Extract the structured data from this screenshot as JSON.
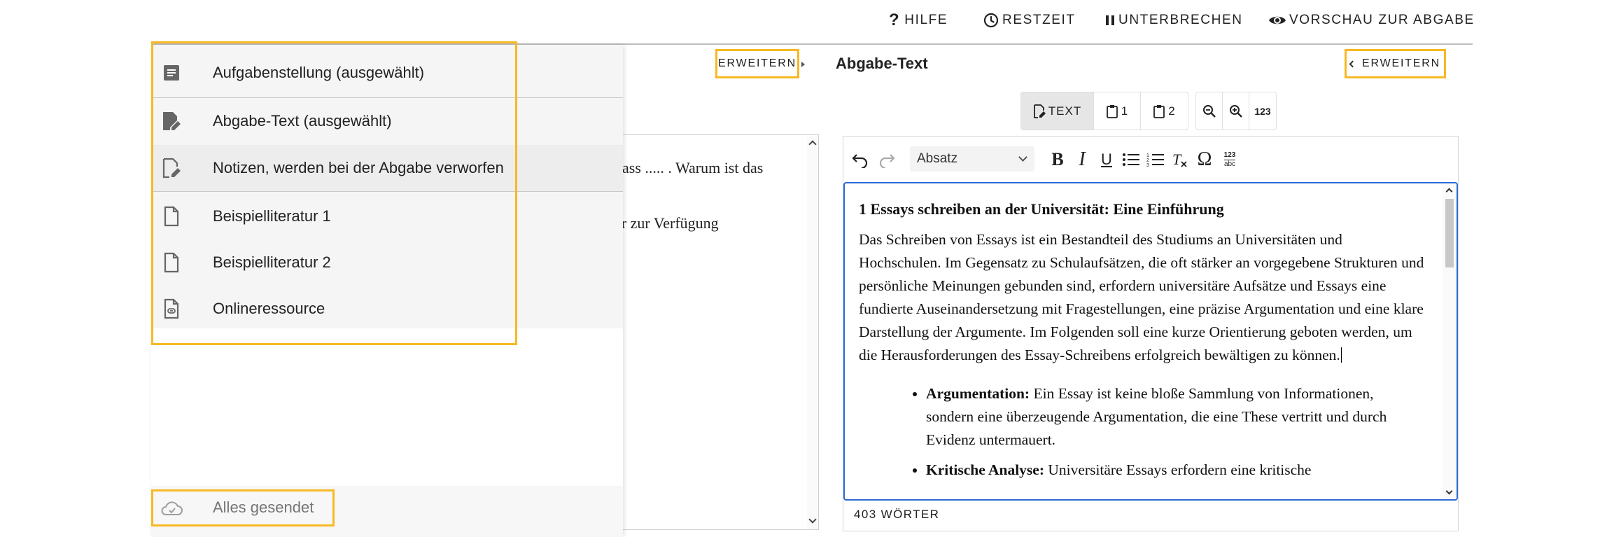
{
  "topbar": {
    "help_label": "HILFE",
    "remaining_label": "RESTZEIT",
    "pause_label": "UNTERBRECHEN",
    "preview_label": "VORSCHAU ZUR ABGABE"
  },
  "left_pane": {
    "expand_label": "ERWEITERN",
    "text_line_1": "dass ..... . Warum ist das",
    "text_line_2": "er zur Verfügung"
  },
  "drawer": {
    "items": [
      {
        "icon": "description-icon",
        "label": "Aufgabenstellung (ausgewählt)"
      },
      {
        "icon": "edit-document-icon",
        "label": "Abgabe-Text (ausgewählt)"
      },
      {
        "icon": "edit-note-icon",
        "label": "Notizen, werden bei der Abgabe verworfen"
      },
      {
        "icon": "file-icon",
        "label": "Beispielliteratur 1"
      },
      {
        "icon": "file-icon",
        "label": "Beispielliteratur 2"
      },
      {
        "icon": "link-file-icon",
        "label": "Onlineressource"
      }
    ],
    "status_label": "Alles gesendet",
    "status_icon": "cloud-done-icon"
  },
  "right_pane": {
    "title": "Abgabe-Text",
    "expand_label": "ERWEITERN",
    "view_toggle": {
      "text_label": "TEXT",
      "page1_label": "1",
      "page2_label": "2"
    },
    "zoom": {
      "counter_label": "123"
    },
    "toolbar": {
      "paragraph_select": "Absatz",
      "spellcheck_top": "123",
      "spellcheck_bottom": "abc"
    },
    "editor": {
      "heading": "1 Essays schreiben an der Universität: Eine Einführung",
      "paragraph": "Das Schreiben von Essays ist ein Bestandteil des Studiums an Universitäten und Hochschulen. Im Gegensatz zu Schulaufsätzen, die oft stärker an vorgegebene Strukturen und persönliche Meinungen gebunden sind, erfordern universitäre Aufsätze und Essays eine fundierte Auseinandersetzung mit Fragestellungen, eine präzise Argumentation und eine klare Darstellung der Argumente. Im Folgenden soll eine kurze Orientierung geboten werden, um die Herausforderungen des Essay-Schreibens erfolgreich bewältigen zu können.",
      "bullets": [
        {
          "term": "Argumentation:",
          "text": " Ein Essay ist keine bloße Sammlung von Informationen, sondern eine überzeugende Argumentation, die eine These vertritt und durch Evidenz untermauert."
        },
        {
          "term": "Kritische Analyse:",
          "text": " Universitäre Essays erfordern eine kritische"
        }
      ]
    },
    "word_count": "403 WÖRTER"
  },
  "colors": {
    "highlight": "#f7b924",
    "focus_border": "#2d6bd7",
    "status_text": "#757575"
  }
}
